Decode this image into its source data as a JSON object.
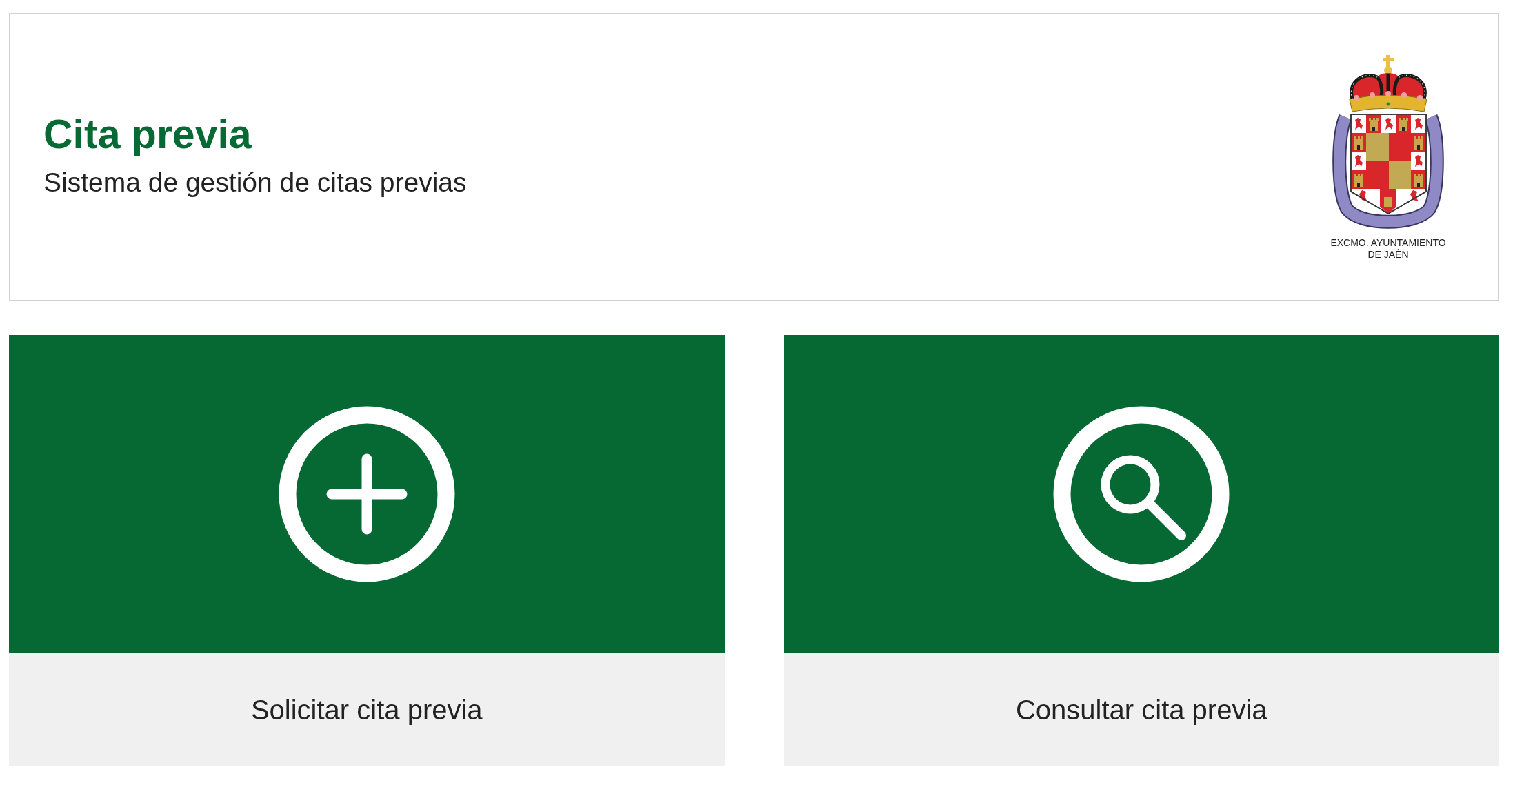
{
  "header": {
    "title": "Cita previa",
    "subtitle": "Sistema de gestión de citas previas",
    "logo_caption": "EXCMO. AYUNTAMIENTO DE JAÉN"
  },
  "actions": [
    {
      "kind": "create",
      "label": "Solicitar cita previa"
    },
    {
      "kind": "search",
      "label": "Consultar cita previa"
    }
  ]
}
